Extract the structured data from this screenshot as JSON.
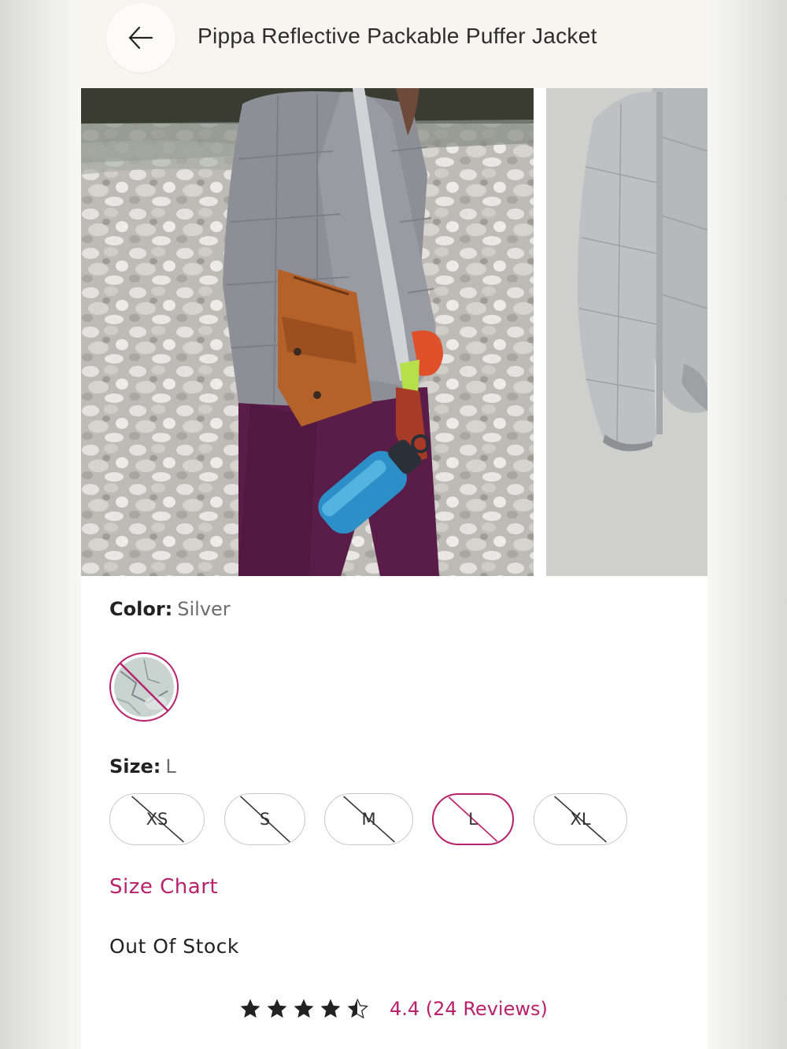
{
  "header": {
    "title": "Pippa Reflective Packable Puffer Jacket",
    "back_icon": "arrow-left-icon"
  },
  "gallery": {
    "images": [
      {
        "alt": "model-photo"
      },
      {
        "alt": "product-photo"
      }
    ]
  },
  "color": {
    "label": "Color:",
    "value": "Silver",
    "swatches": [
      {
        "name": "Silver",
        "selected": true,
        "available": false
      }
    ]
  },
  "size": {
    "label": "Size:",
    "value": "L",
    "options": [
      {
        "label": "XS",
        "available": false,
        "selected": false
      },
      {
        "label": "S",
        "available": false,
        "selected": false
      },
      {
        "label": "M",
        "available": false,
        "selected": false
      },
      {
        "label": "L",
        "available": false,
        "selected": true
      },
      {
        "label": "XL",
        "available": false,
        "selected": false
      }
    ]
  },
  "size_chart_label": "Size Chart",
  "stock_status": "Out Of Stock",
  "rating": {
    "value": 4.4,
    "text": "4.4 (24 Reviews)",
    "max": 5
  },
  "colors": {
    "accent": "#b8226a",
    "header_bg": "#f8f5f1",
    "text": "#222222",
    "muted": "#6d6d6d"
  }
}
